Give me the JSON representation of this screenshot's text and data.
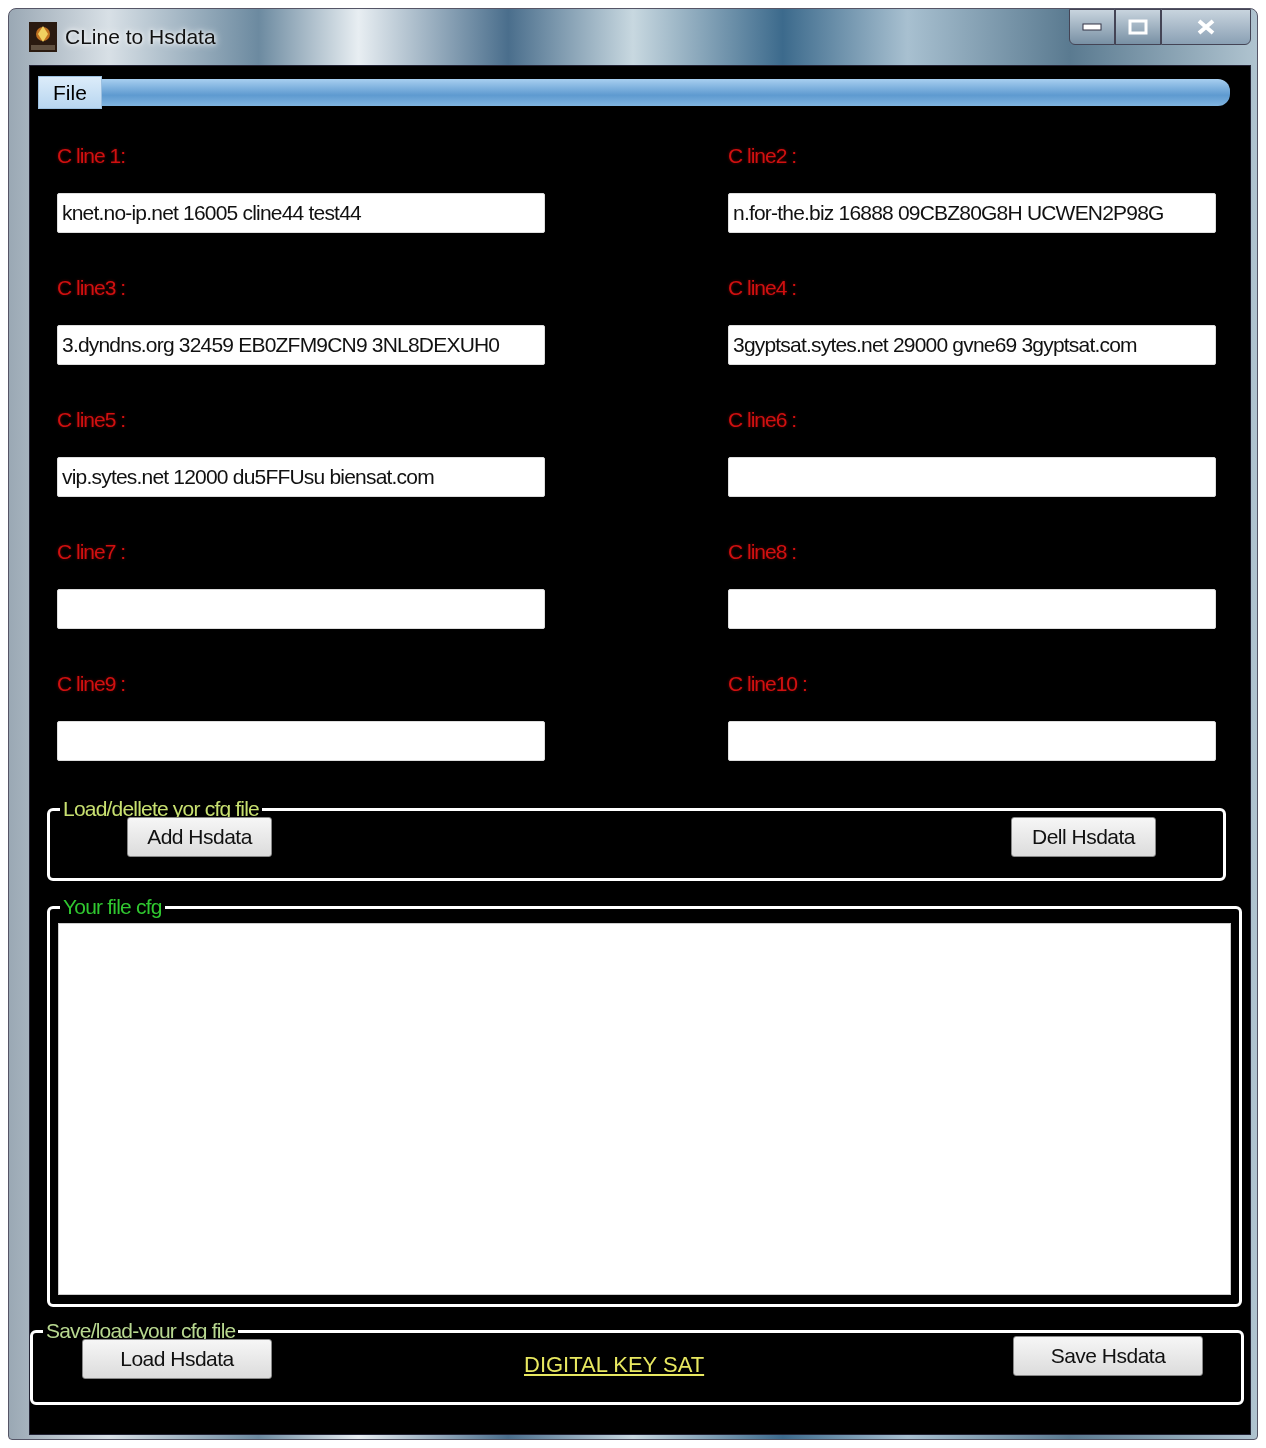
{
  "window": {
    "title": "CLine to Hsdata"
  },
  "menu": [
    {
      "label": "File",
      "selected": true
    }
  ],
  "clines": [
    {
      "label": "C line 1:",
      "value": "knet.no-ip.net 16005 cline44 test44"
    },
    {
      "label": "C line2 :",
      "value": "n.for-the.biz 16888 09CBZ80G8H UCWEN2P98G"
    },
    {
      "label": "C line3 :",
      "value": "3.dyndns.org 32459 EB0ZFM9CN9 3NL8DEXUH0"
    },
    {
      "label": "C line4 :",
      "value": "3gyptsat.sytes.net 29000 gvne69 3gyptsat.com"
    },
    {
      "label": "C line5 :",
      "value": "vip.sytes.net 12000 du5FFUsu biensat.com"
    },
    {
      "label": "C line6 :"
    },
    {
      "label": "C line7 :"
    },
    {
      "label": "C line8 :"
    },
    {
      "label": "C line9 :"
    },
    {
      "label": "C line10 :"
    }
  ],
  "load_delete_group": {
    "title": "Load/dellete yor cfg file",
    "buttons": [
      "Add Hsdata",
      "Dell Hsdata"
    ]
  },
  "cfg_group": {
    "title": "Your file cfg"
  },
  "save_load_group": {
    "title": "Save/load-your cfg file",
    "buttons": [
      "Load Hsdata",
      "Save Hsdata"
    ],
    "link": "DIGITAL KEY SAT"
  }
}
